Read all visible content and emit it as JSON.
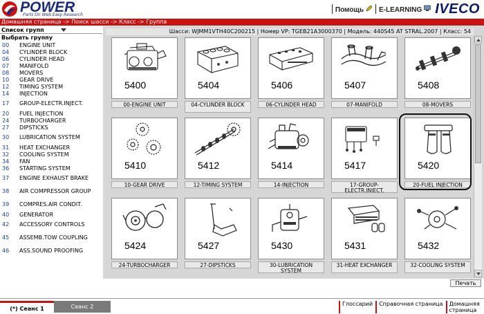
{
  "header": {
    "logo_word": "POWER",
    "logo_tagline": "Parts On Web Easy Research",
    "help_label": "Помощь",
    "elearning_label": "E-LEARNING",
    "brand": "IVECO"
  },
  "breadcrumb": "Домашняя страница -> Поиск шасси -> Класс -> Группа",
  "sidebar": {
    "title": "Список групп",
    "subtitle": "Выбрать группу",
    "groups": [
      {
        "num": "00",
        "label": "ENGINE UNIT"
      },
      {
        "num": "04",
        "label": "CYLINDER BLOCK"
      },
      {
        "num": "06",
        "label": "CYLINDER HEAD"
      },
      {
        "num": "07",
        "label": "MANIFOLD"
      },
      {
        "num": "08",
        "label": "MOVERS"
      },
      {
        "num": "10",
        "label": "GEAR DRIVE"
      },
      {
        "num": "12",
        "label": "TIMING SYSTEM"
      },
      {
        "num": "14",
        "label": "INJECTION"
      },
      {
        "num": "17",
        "label": "GROUP-ELECTR.INJECT."
      },
      {
        "num": "20",
        "label": "FUEL INJECTION"
      },
      {
        "num": "24",
        "label": "TURBOCHARGER"
      },
      {
        "num": "27",
        "label": "DIPSTICKS"
      },
      {
        "num": "30",
        "label": "LUBRICATION SYSTEM"
      },
      {
        "num": "31",
        "label": "HEAT EXCHANGER"
      },
      {
        "num": "32",
        "label": "COOLING SYSTEM"
      },
      {
        "num": "34",
        "label": "FAN"
      },
      {
        "num": "36",
        "label": "STARTING SYSTEM"
      },
      {
        "num": "37",
        "label": "ENGINE EXHAUST BRAKE"
      },
      {
        "num": "38",
        "label": "AIR COMPRESSOR GROUP"
      },
      {
        "num": "39",
        "label": "COMPRES.AIR CONDIT."
      },
      {
        "num": "40",
        "label": "GENERATOR"
      },
      {
        "num": "42",
        "label": "ACCESSORY CONTROLS"
      },
      {
        "num": "45",
        "label": "ASSEMB.TOW COUPLING"
      },
      {
        "num": "46",
        "label": "ASS.SOUND PROOFING"
      }
    ]
  },
  "info_bar": "Шасси: WJMM1VTH40C200215 | Номер VP: TGEB21A3000370 | Модель: 440S45 AT STRAL.2007 | Класс: 54",
  "cards": [
    {
      "code": "5400",
      "caption": "00-ENGINE UNIT"
    },
    {
      "code": "5404",
      "caption": "04-CYLINDER BLOCK"
    },
    {
      "code": "5406",
      "caption": "06-CYLINDER HEAD"
    },
    {
      "code": "5407",
      "caption": "07-MANIFOLD"
    },
    {
      "code": "5408",
      "caption": "08-MOVERS"
    },
    {
      "code": "5410",
      "caption": "10-GEAR DRIVE"
    },
    {
      "code": "5412",
      "caption": "12-TIMING SYSTEM"
    },
    {
      "code": "5414",
      "caption": "14-INJECTION"
    },
    {
      "code": "5417",
      "caption": "17-GROUP-ELECTR.INJECT."
    },
    {
      "code": "5420",
      "caption": "20-FUEL INJECTION"
    },
    {
      "code": "5424",
      "caption": "24-TURBOCHARGER"
    },
    {
      "code": "5427",
      "caption": "27-DIPSTICKS"
    },
    {
      "code": "5430",
      "caption": "30-LUBRICATION SYSTEM"
    },
    {
      "code": "5431",
      "caption": "31-HEAT EXCHANGER"
    },
    {
      "code": "5432",
      "caption": "32-COOLING SYSTEM"
    }
  ],
  "print_label": "Печать",
  "footer": {
    "session1": "(*) Сеанс 1",
    "session2": "Сеанс 2",
    "links": [
      "Глоссарий",
      "Справочная страница",
      "Домашняя страница"
    ]
  },
  "colors": {
    "accent_red": "#cc1111",
    "brand_blue": "#0b1d6a",
    "group_num_blue": "#1b3ea0",
    "panel_gray": "#d6d6d6"
  }
}
